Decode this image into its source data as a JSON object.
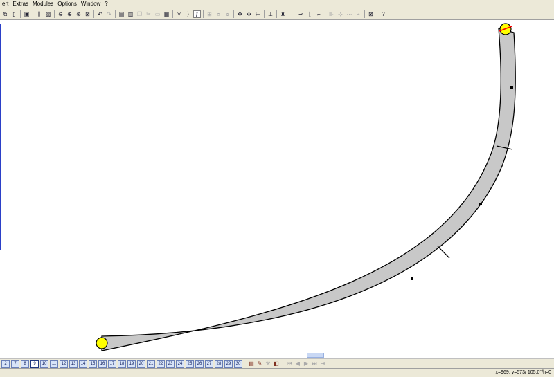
{
  "menubar": {
    "items": [
      "ert",
      "Extras",
      "Modules",
      "Options",
      "Window",
      "?"
    ]
  },
  "toolbar": {
    "buttons": [
      {
        "icon": "copy-window-icon",
        "glyph": "⧉",
        "dim": false
      },
      {
        "icon": "clipboard-icon",
        "glyph": "▯",
        "dim": false
      },
      {
        "sep": true
      },
      {
        "icon": "track-library-icon",
        "glyph": "▣",
        "dim": false
      },
      {
        "sep": true
      },
      {
        "icon": "properties-icon",
        "glyph": "⫼",
        "dim": false
      },
      {
        "icon": "landscape-icon",
        "glyph": "▨",
        "dim": false
      },
      {
        "sep": true
      },
      {
        "icon": "zoom-out-icon",
        "glyph": "⊖",
        "dim": false
      },
      {
        "icon": "zoom-in-icon",
        "glyph": "⊕",
        "dim": false
      },
      {
        "icon": "zoom-fit-icon",
        "glyph": "⊛",
        "dim": false
      },
      {
        "icon": "zoom-all-icon",
        "glyph": "⊠",
        "dim": false
      },
      {
        "sep": true
      },
      {
        "icon": "undo-icon",
        "glyph": "↶",
        "dim": false
      },
      {
        "icon": "redo-icon",
        "glyph": "↷",
        "dim": true
      },
      {
        "sep": true
      },
      {
        "icon": "new-sheet-icon",
        "glyph": "▤",
        "dim": false
      },
      {
        "icon": "sheet-icon",
        "glyph": "▥",
        "dim": false
      },
      {
        "icon": "copy-icon",
        "glyph": "❐",
        "dim": true
      },
      {
        "icon": "cut-icon",
        "glyph": "✂",
        "dim": true
      },
      {
        "icon": "paste-icon",
        "glyph": "▭",
        "dim": true
      },
      {
        "icon": "save-icon",
        "glyph": "▦",
        "dim": false
      },
      {
        "sep": true
      },
      {
        "icon": "flex-track-icon",
        "glyph": "⋎",
        "dim": false
      },
      {
        "icon": "curve-icon",
        "glyph": "⟩",
        "dim": false
      },
      {
        "icon": "freehand-icon",
        "glyph": "ƒ",
        "dim": false,
        "pressed": true
      },
      {
        "sep": true
      },
      {
        "icon": "align-icon",
        "glyph": "⊞",
        "dim": true
      },
      {
        "icon": "group-icon",
        "glyph": "⧈",
        "dim": true
      },
      {
        "icon": "ungroup-icon",
        "glyph": "⧇",
        "dim": true
      },
      {
        "sep": true
      },
      {
        "icon": "connect-icon",
        "glyph": "✥",
        "dim": false
      },
      {
        "icon": "disconnect-icon",
        "glyph": "✣",
        "dim": false
      },
      {
        "icon": "measure-icon",
        "glyph": "⊢",
        "dim": false
      },
      {
        "sep": true
      },
      {
        "icon": "height-icon",
        "glyph": "⊥",
        "dim": false
      },
      {
        "sep": true
      },
      {
        "icon": "signal-icon",
        "glyph": "♜",
        "dim": false
      },
      {
        "icon": "rail-end-icon",
        "glyph": "⊤",
        "dim": false
      },
      {
        "icon": "straight-track-icon",
        "glyph": "⊸",
        "dim": false
      },
      {
        "icon": "gradient-icon",
        "glyph": "⌊",
        "dim": false
      },
      {
        "icon": "slope-icon",
        "glyph": "⌐",
        "dim": false
      },
      {
        "sep": true
      },
      {
        "icon": "section-icon",
        "glyph": "⊪",
        "dim": true
      },
      {
        "icon": "grid-icon",
        "glyph": "⊹",
        "dim": true
      },
      {
        "icon": "snap-icon",
        "glyph": "⋯",
        "dim": true
      },
      {
        "icon": "route-icon",
        "glyph": "⌁",
        "dim": true
      },
      {
        "sep": true
      },
      {
        "icon": "center-icon",
        "glyph": "⊠",
        "dim": false
      },
      {
        "sep": true
      },
      {
        "icon": "help-icon",
        "glyph": "?",
        "dim": false
      }
    ]
  },
  "layers": {
    "labels": [
      "2",
      "7",
      "8",
      "9",
      "10",
      "11",
      "12",
      "13",
      "14",
      "15",
      "16",
      "17",
      "18",
      "19",
      "20",
      "21",
      "22",
      "23",
      "24",
      "25",
      "26",
      "27",
      "28",
      "29",
      "30"
    ],
    "active_index": 3,
    "tools": [
      {
        "icon": "layer-color-icon",
        "glyph": "▤",
        "dim": false
      },
      {
        "icon": "layer-edit-icon",
        "glyph": "✎",
        "dim": false
      },
      {
        "icon": "layer-tools-icon",
        "glyph": "⚒",
        "dim": true
      },
      {
        "icon": "layer-3d-icon",
        "glyph": "◧",
        "dim": false
      },
      {
        "icon": "layer-first-icon",
        "glyph": "⏮",
        "dim": true
      },
      {
        "icon": "layer-prev-icon",
        "glyph": "◀",
        "dim": true
      },
      {
        "icon": "layer-next-icon",
        "glyph": "▶",
        "dim": true
      },
      {
        "icon": "layer-last-icon",
        "glyph": "⏭",
        "dim": true
      },
      {
        "icon": "layer-end-icon",
        "glyph": "⇥",
        "dim": true
      }
    ]
  },
  "status": {
    "coords": "x=969, y=573/ 105.0°/h=0"
  },
  "drawing": {
    "track_fill": "#c8c8c8",
    "track_stroke": "#000000",
    "endpoint_fill": "#ffff00",
    "endpoint_marker": "#ff0000"
  }
}
